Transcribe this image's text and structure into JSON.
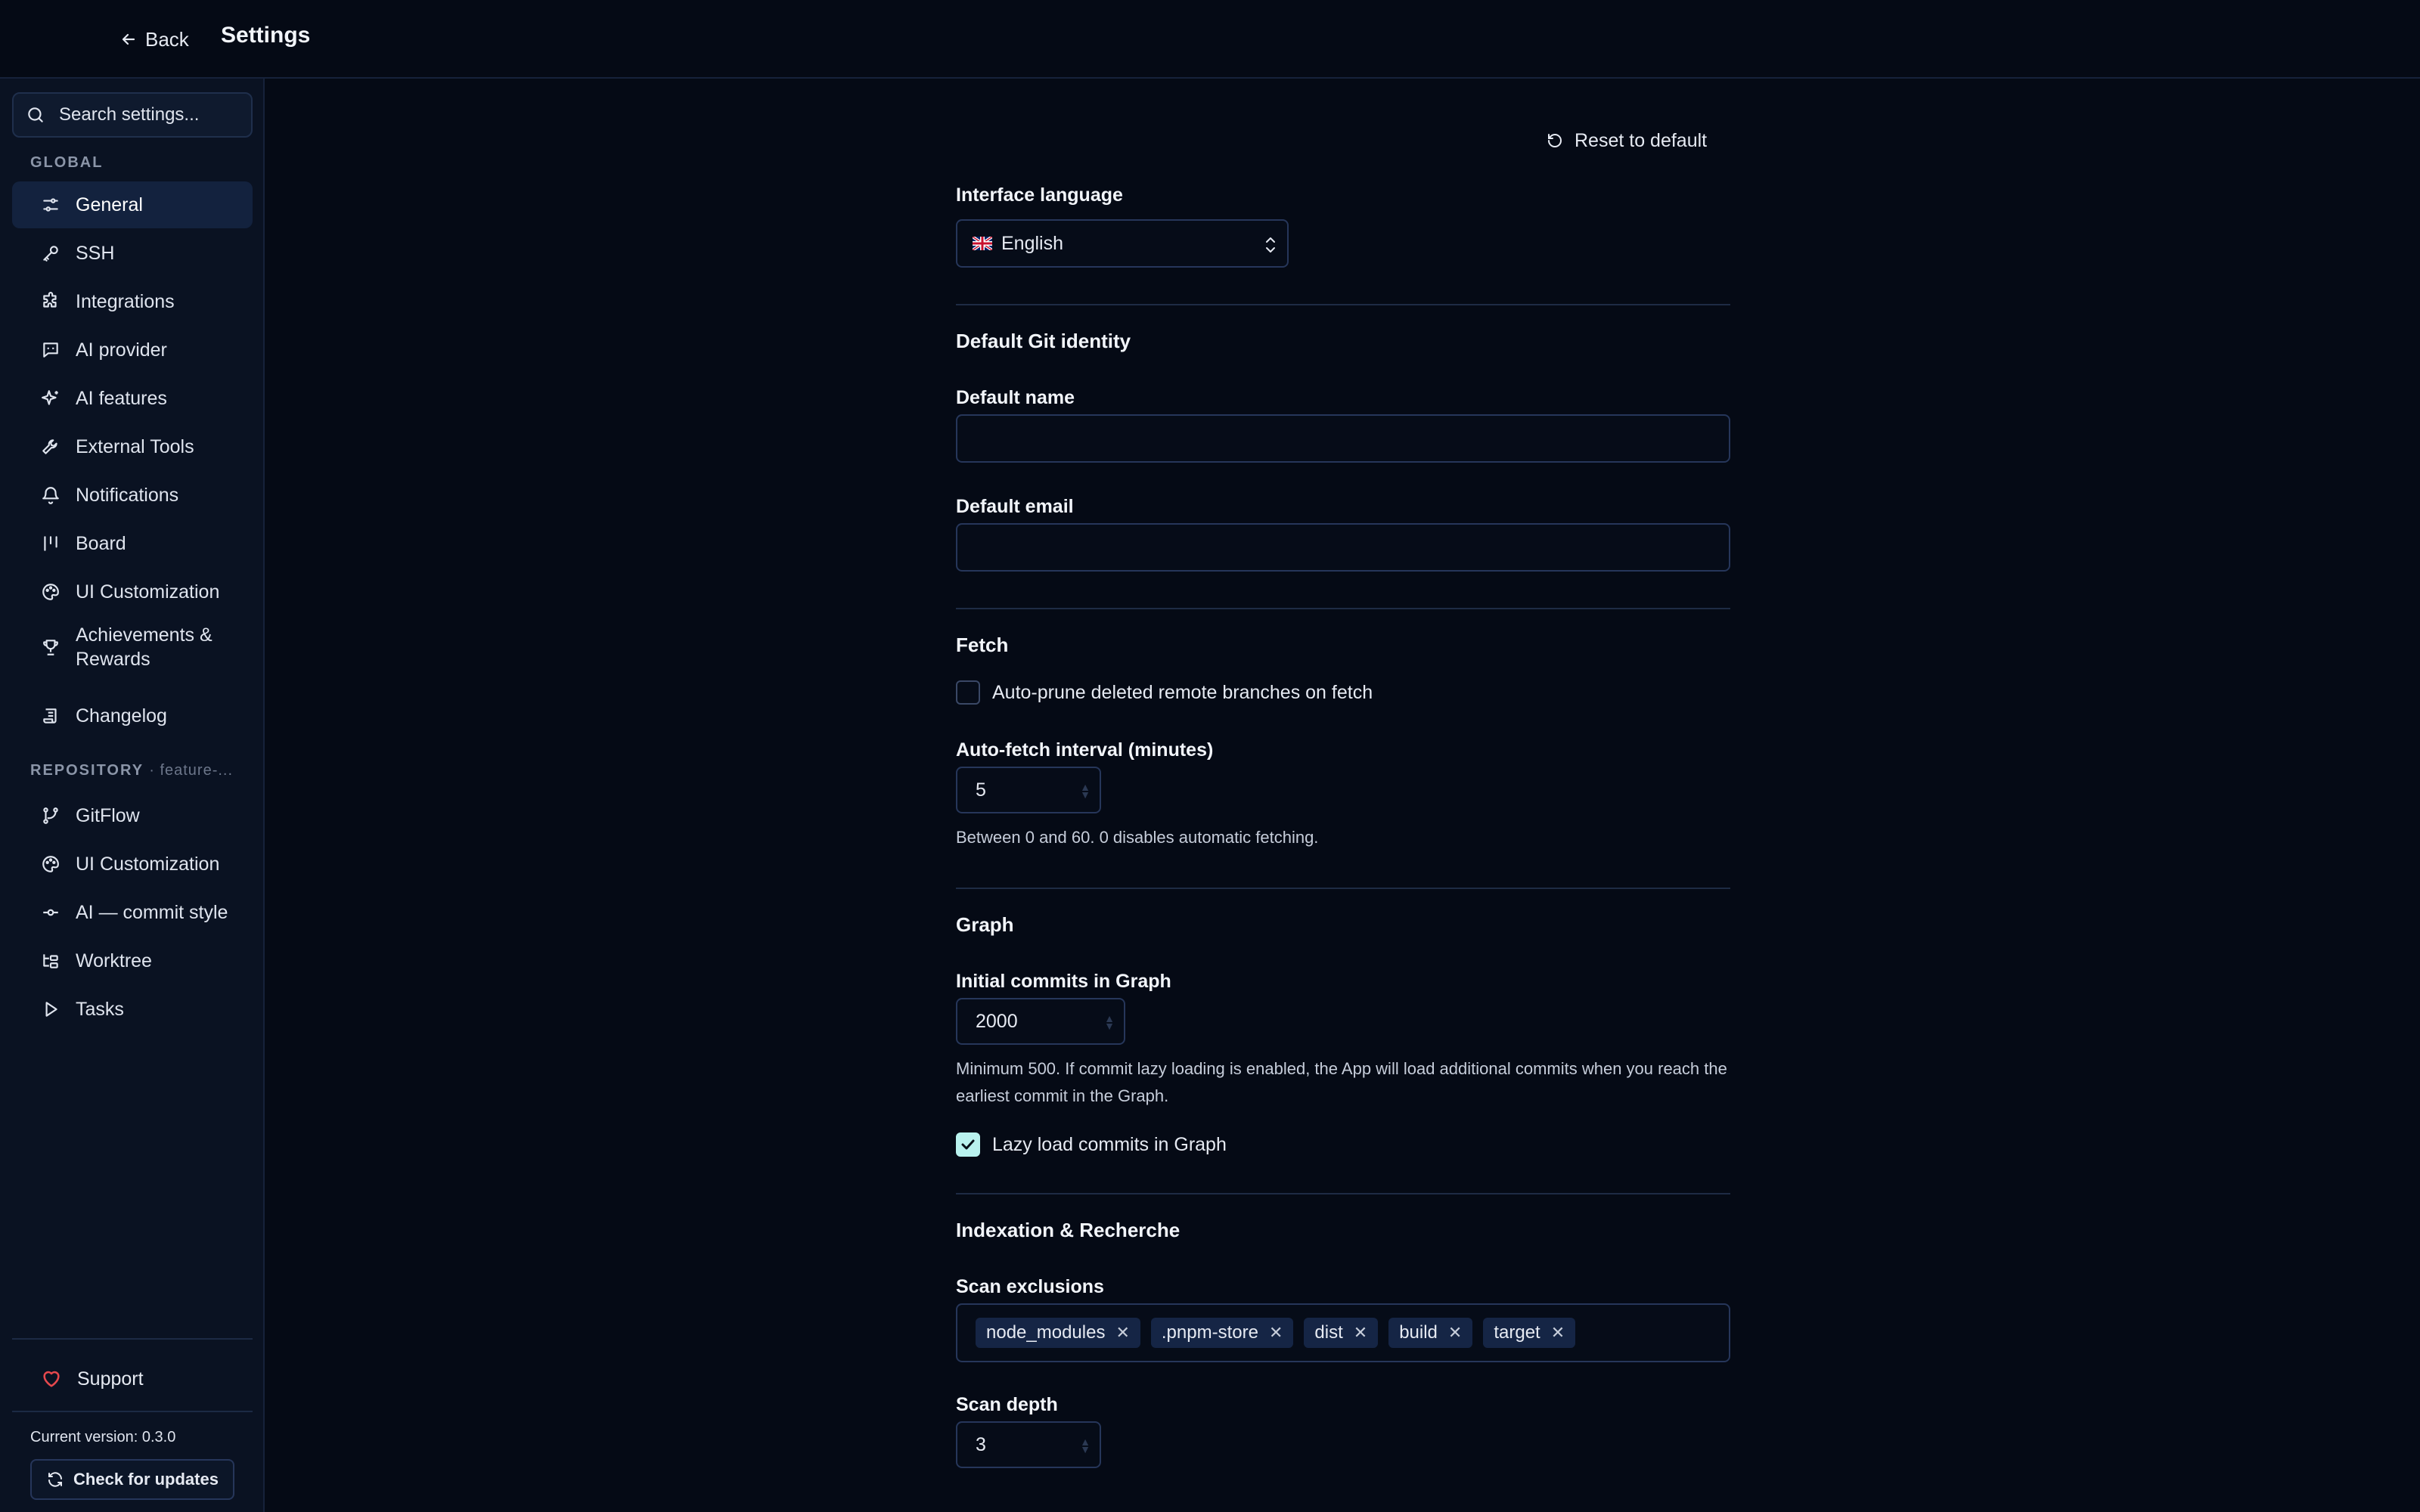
{
  "header": {
    "back_label": "Back",
    "title": "Settings"
  },
  "sidebar": {
    "search_placeholder": "Search settings...",
    "global_label": "GLOBAL",
    "global_items": [
      {
        "label": "General",
        "icon": "sliders-icon",
        "active": true
      },
      {
        "label": "SSH",
        "icon": "key-icon"
      },
      {
        "label": "Integrations",
        "icon": "puzzle-icon"
      },
      {
        "label": "AI provider",
        "icon": "message-square-icon"
      },
      {
        "label": "AI features",
        "icon": "sparkles-icon"
      },
      {
        "label": "External Tools",
        "icon": "wrench-icon"
      },
      {
        "label": "Notifications",
        "icon": "bell-icon"
      },
      {
        "label": "Board",
        "icon": "kanban-icon"
      },
      {
        "label": "UI Customization",
        "icon": "palette-icon"
      },
      {
        "label": "Achievements & Rewards",
        "icon": "trophy-icon"
      },
      {
        "label": "Changelog",
        "icon": "scroll-icon"
      }
    ],
    "repository_label": "REPOSITORY",
    "repository_sub": "· feature-...",
    "repository_items": [
      {
        "label": "GitFlow",
        "icon": "git-branch-icon"
      },
      {
        "label": "UI Customization",
        "icon": "palette-icon"
      },
      {
        "label": "AI — commit style",
        "icon": "git-commit-icon"
      },
      {
        "label": "Worktree",
        "icon": "folder-tree-icon"
      },
      {
        "label": "Tasks",
        "icon": "play-icon"
      }
    ],
    "support_label": "Support",
    "version_text": "Current version: 0.3.0",
    "update_label": "Check for updates"
  },
  "main": {
    "reset_label": "Reset to default",
    "interface_language_label": "Interface language",
    "language_value": "English",
    "git_identity_title": "Default Git identity",
    "default_name_label": "Default name",
    "default_name_value": "",
    "default_email_label": "Default email",
    "default_email_value": "",
    "fetch_title": "Fetch",
    "auto_prune_label": "Auto-prune deleted remote branches on fetch",
    "auto_prune_checked": false,
    "auto_fetch_label": "Auto-fetch interval (minutes)",
    "auto_fetch_value": "5",
    "auto_fetch_help": "Between 0 and 60. 0 disables automatic fetching.",
    "graph_title": "Graph",
    "initial_commits_label": "Initial commits in Graph",
    "initial_commits_value": "2000",
    "initial_commits_help": "Minimum 500. If commit lazy loading is enabled, the App will load additional commits when you reach the earliest commit in the Graph.",
    "lazy_load_label": "Lazy load commits in Graph",
    "lazy_load_checked": true,
    "indexation_title": "Indexation & Recherche",
    "scan_exclusions_label": "Scan exclusions",
    "scan_exclusions": [
      "node_modules",
      ".pnpm-store",
      "dist",
      "build",
      "target"
    ],
    "scan_depth_label": "Scan depth",
    "scan_depth_value": "3"
  },
  "colors": {
    "accent": "#b9f2ee",
    "background": "#050a15",
    "sidebar": "#0a1222",
    "active_item": "#13223e",
    "heart": "#e5484d"
  }
}
